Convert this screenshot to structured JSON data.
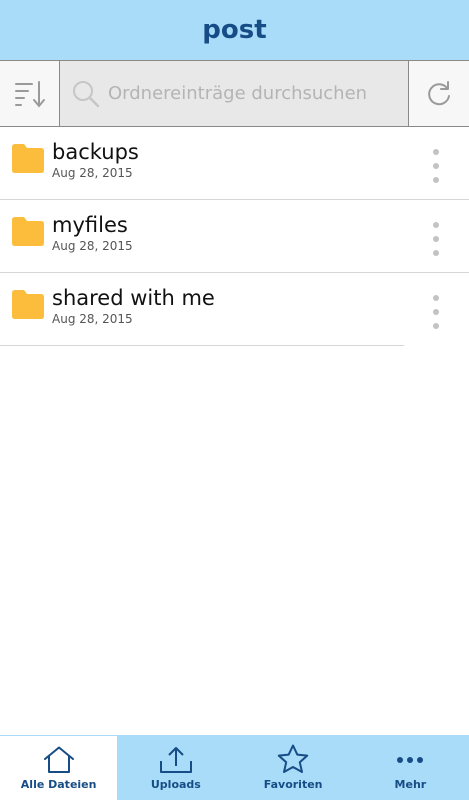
{
  "header": {
    "title": "post"
  },
  "toolbar": {
    "sort_icon": "sort-icon",
    "search_icon": "search-icon",
    "search_placeholder": "Ordnereinträge durchsuchen",
    "refresh_icon": "refresh-icon"
  },
  "list": {
    "items": [
      {
        "name": "backups",
        "date": "Aug 28, 2015",
        "icon": "folder-icon"
      },
      {
        "name": "myfiles",
        "date": "Aug 28, 2015",
        "icon": "folder-icon"
      },
      {
        "name": "shared with me",
        "date": "Aug 28, 2015",
        "icon": "folder-icon"
      }
    ]
  },
  "tabbar": {
    "tabs": [
      {
        "label": "Alle Dateien",
        "icon": "home-icon",
        "active": true
      },
      {
        "label": "Uploads",
        "icon": "upload-icon",
        "active": false
      },
      {
        "label": "Favoriten",
        "icon": "star-icon",
        "active": false
      },
      {
        "label": "Mehr",
        "icon": "more-icon",
        "active": false
      }
    ]
  },
  "colors": {
    "header_bg": "#a8dcf8",
    "brand_text": "#174d86",
    "folder": "#fbbd3b",
    "divider": "#d6d6d6"
  }
}
